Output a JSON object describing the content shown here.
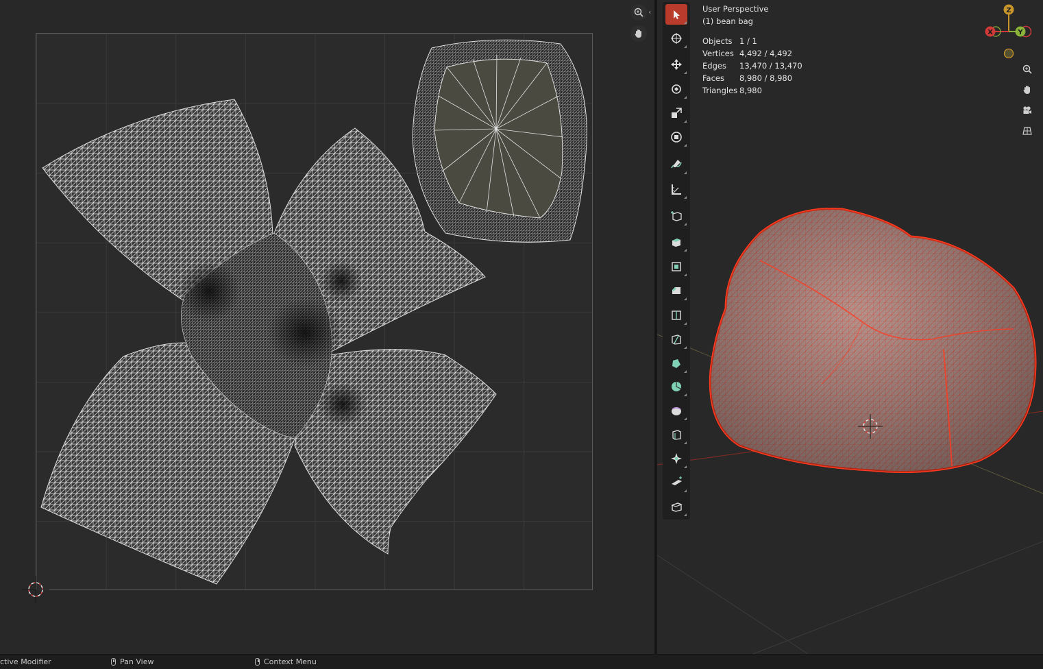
{
  "viewport": {
    "view_name": "User Perspective",
    "object_name": "(1) bean bag",
    "stats": [
      {
        "label": "Objects",
        "value": "1 / 1"
      },
      {
        "label": "Vertices",
        "value": "4,492 / 4,492"
      },
      {
        "label": "Edges",
        "value": "13,470 / 13,470"
      },
      {
        "label": "Faces",
        "value": "8,980 / 8,980"
      },
      {
        "label": "Triangles",
        "value": "8,980"
      }
    ],
    "gizmo": {
      "z": "Z",
      "y": "Y",
      "x": "X"
    },
    "colors": {
      "selection": "#ff3a1f",
      "mesh_fill": "#b08a84",
      "active_tool": "#b93b2c",
      "x_axis": "#d23a3a",
      "y_axis": "#8bb33a",
      "z_axis": "#c9962b"
    }
  },
  "toolbar": [
    "select-box",
    "cursor",
    "move",
    "rotate",
    "scale",
    "transform",
    "annotate",
    "measure",
    "add-cube",
    "extrude-region",
    "inset-faces",
    "bevel",
    "loop-cut",
    "knife",
    "poly-build",
    "spin",
    "smooth",
    "edge-slide",
    "shrink-fatten",
    "shear",
    "rip-region"
  ],
  "status_bar": {
    "item1": "ctive Modifier",
    "item2": "Pan View",
    "item3": "Context Menu"
  }
}
